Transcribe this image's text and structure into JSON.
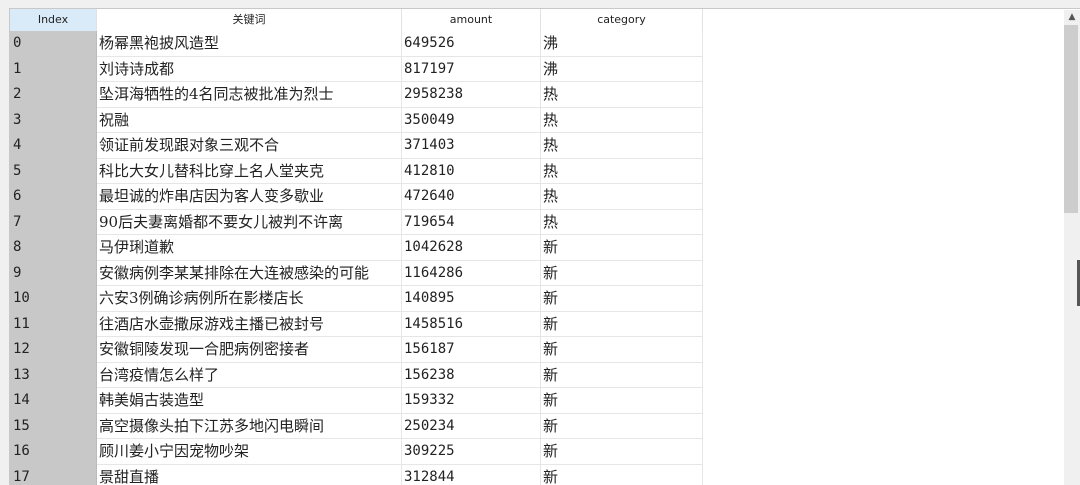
{
  "table": {
    "columns": [
      "Index",
      "关键词",
      "amount",
      "category"
    ],
    "rows": [
      [
        "0",
        "杨幂黑袍披风造型",
        "649526",
        "沸"
      ],
      [
        "1",
        "刘诗诗成都",
        "817197",
        "沸"
      ],
      [
        "2",
        "坠洱海牺牲的4名同志被批准为烈士",
        "2958238",
        "热"
      ],
      [
        "3",
        "祝融",
        "350049",
        "热"
      ],
      [
        "4",
        "领证前发现跟对象三观不合",
        "371403",
        "热"
      ],
      [
        "5",
        "科比大女儿替科比穿上名人堂夹克",
        "412810",
        "热"
      ],
      [
        "6",
        "最坦诚的炸串店因为客人变多歇业",
        "472640",
        "热"
      ],
      [
        "7",
        "90后夫妻离婚都不要女儿被判不许离",
        "719654",
        "热"
      ],
      [
        "8",
        "马伊琍道歉",
        "1042628",
        "新"
      ],
      [
        "9",
        "安徽病例李某某排除在大连被感染的可能",
        "1164286",
        "新"
      ],
      [
        "10",
        "六安3例确诊病例所在影楼店长",
        "140895",
        "新"
      ],
      [
        "11",
        "往酒店水壶撒尿游戏主播已被封号",
        "1458516",
        "新"
      ],
      [
        "12",
        "安徽铜陵发现一合肥病例密接者",
        "156187",
        "新"
      ],
      [
        "13",
        "台湾疫情怎么样了",
        "156238",
        "新"
      ],
      [
        "14",
        "韩美娟古装造型",
        "159332",
        "新"
      ],
      [
        "15",
        "高空摄像头拍下江苏多地闪电瞬间",
        "250234",
        "新"
      ],
      [
        "16",
        "顾川姜小宁因宠物吵架",
        "309225",
        "新"
      ],
      [
        "17",
        "景甜直播",
        "312844",
        "新"
      ]
    ]
  },
  "scrollbar": {
    "up_icon": "chevron-up-icon",
    "position_fraction": 0
  }
}
